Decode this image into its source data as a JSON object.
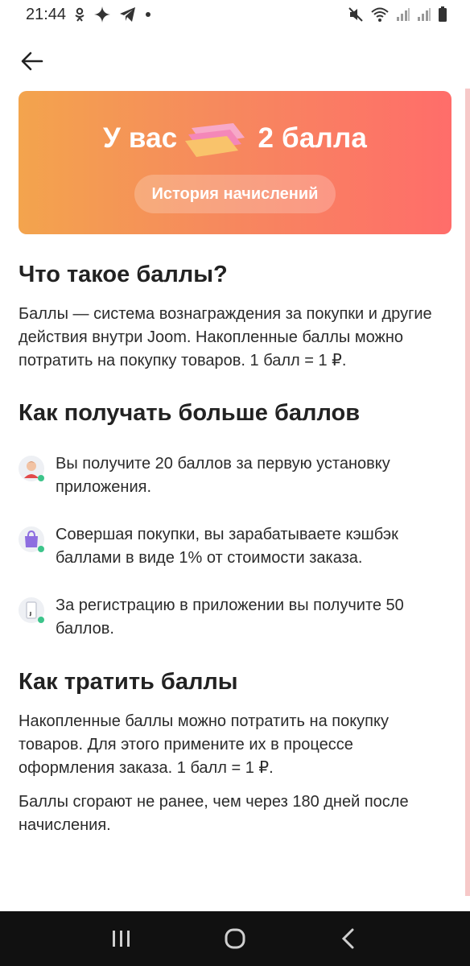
{
  "status_bar": {
    "time": "21:44"
  },
  "hero": {
    "title_prefix": "У вас",
    "title_suffix": "2 балла",
    "history_button": "История начислений"
  },
  "section_what": {
    "title": "Что такое баллы?",
    "text": "Баллы — система вознаграждения за покупки и другие действия внутри Joom. Накопленные баллы можно потратить на покупку товаров.  1 балл = 1 ₽."
  },
  "section_earn": {
    "title": "Как получать больше баллов",
    "items": [
      {
        "icon": "user-avatar-icon",
        "text": "Вы получите 20 баллов за первую установку приложения."
      },
      {
        "icon": "shopping-bag-icon",
        "text": "Совершая покупки, вы зарабатываете кэшбэк баллами в виде 1% от стоимости заказа."
      },
      {
        "icon": "phone-registration-icon",
        "text": "За регистрацию в приложении вы получите 50 баллов."
      }
    ]
  },
  "section_spend": {
    "title": "Как тратить баллы",
    "text1": "Накопленные баллы можно потратить на покупку товаров. Для этого примените их в процессе оформления заказа. 1 балл = 1 ₽.",
    "text2": "Баллы сгорают не ранее, чем через 180 дней после начисления."
  },
  "colors": {
    "hero_start": "#f3a44d",
    "hero_end": "#ff6d6a",
    "accent_green": "#3cc48a"
  }
}
